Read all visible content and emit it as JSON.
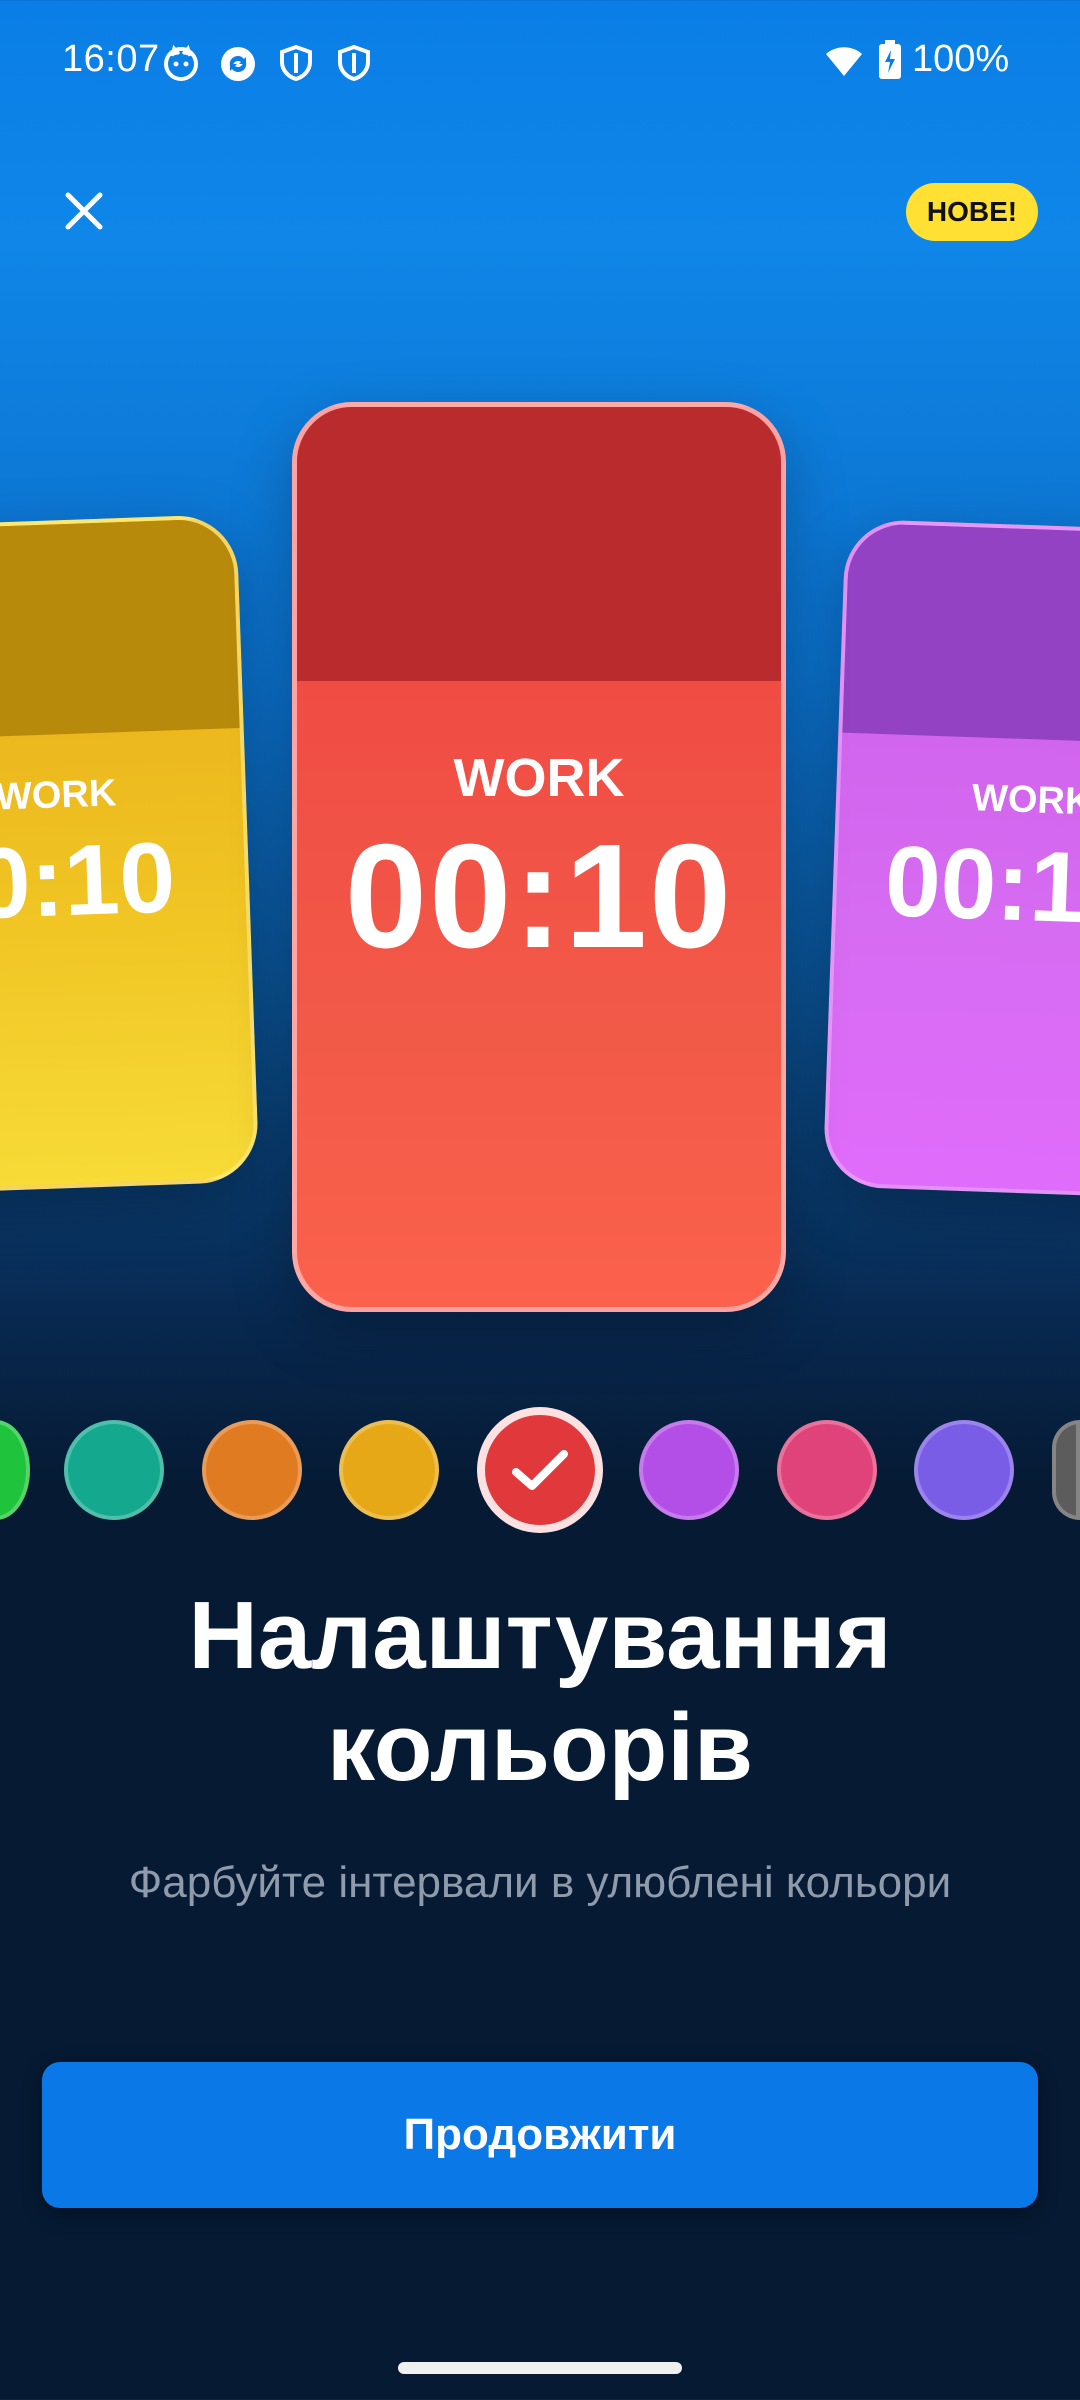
{
  "status_bar": {
    "time": "16:07",
    "battery": "100%",
    "icons_left": [
      "cat-face-icon",
      "sync-icon",
      "shield-icon",
      "shield-icon"
    ],
    "icons_right": [
      "wifi-icon",
      "battery-charging-icon"
    ]
  },
  "header": {
    "close_icon": "close-icon",
    "badge": "НОВЕ!"
  },
  "cards": {
    "left": {
      "label": "WORK",
      "time": "0:10",
      "color": "#e7aa16"
    },
    "center": {
      "label": "WORK",
      "time": "00:10",
      "color": "#ef4141"
    },
    "right": {
      "label": "WORK",
      "time": "00:1",
      "color": "#cc5de8"
    }
  },
  "swatches": [
    {
      "color": "#1fc43c",
      "selected": false
    },
    {
      "color": "#14a98f",
      "selected": false
    },
    {
      "color": "#e07b22",
      "selected": false
    },
    {
      "color": "#e6a817",
      "selected": false
    },
    {
      "color": "#e1383c",
      "selected": true
    },
    {
      "color": "#b34fe6",
      "selected": false
    },
    {
      "color": "#e0437a",
      "selected": false
    },
    {
      "color": "#7a5de6",
      "selected": false
    },
    {
      "color": "#5c5c5c",
      "selected": false
    }
  ],
  "content": {
    "title_line1": "Налаштування",
    "title_line2": "кольорів",
    "subtitle": "Фарбуйте інтервали в улюблені кольори",
    "continue_label": "Продовжити"
  }
}
